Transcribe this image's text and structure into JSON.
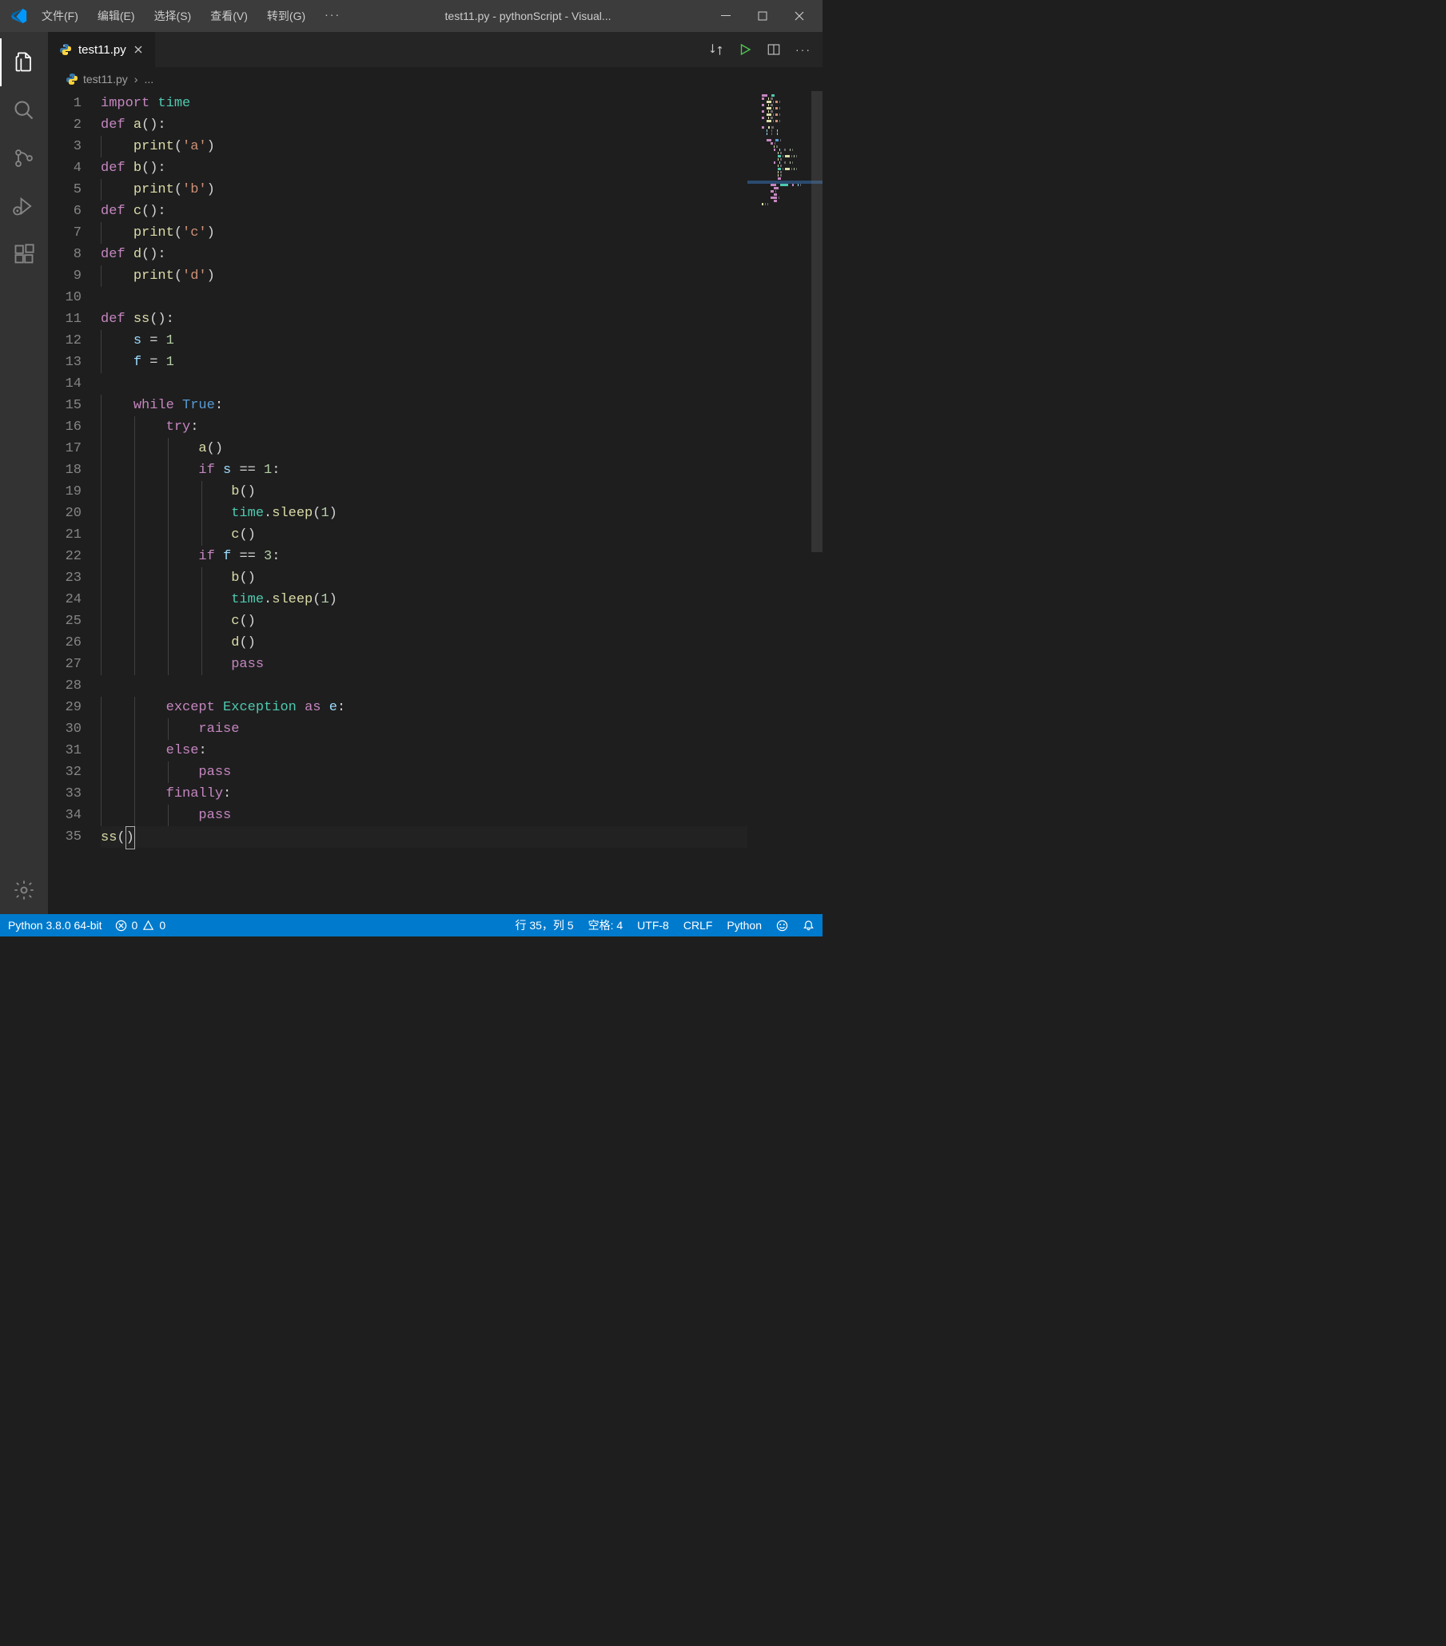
{
  "titlebar": {
    "menus": [
      "文件(F)",
      "编辑(E)",
      "选择(S)",
      "查看(V)",
      "转到(G)"
    ],
    "overflow": "···",
    "title": "test11.py - pythonScript - Visual..."
  },
  "tab": {
    "filename": "test11.py"
  },
  "breadcrumb": {
    "file": "test11.py",
    "sep": "›",
    "more": "..."
  },
  "code": {
    "lines": [
      [
        [
          "kw",
          "import"
        ],
        [
          "plain",
          " "
        ],
        [
          "mod",
          "time"
        ]
      ],
      [
        [
          "kw",
          "def"
        ],
        [
          "plain",
          " "
        ],
        [
          "fn",
          "a"
        ],
        [
          "pun",
          "():"
        ]
      ],
      [
        [
          "plain",
          "    "
        ],
        [
          "fn",
          "print"
        ],
        [
          "pun",
          "("
        ],
        [
          "str",
          "'a'"
        ],
        [
          "pun",
          ")"
        ]
      ],
      [
        [
          "kw",
          "def"
        ],
        [
          "plain",
          " "
        ],
        [
          "fn",
          "b"
        ],
        [
          "pun",
          "():"
        ]
      ],
      [
        [
          "plain",
          "    "
        ],
        [
          "fn",
          "print"
        ],
        [
          "pun",
          "("
        ],
        [
          "str",
          "'b'"
        ],
        [
          "pun",
          ")"
        ]
      ],
      [
        [
          "kw",
          "def"
        ],
        [
          "plain",
          " "
        ],
        [
          "fn",
          "c"
        ],
        [
          "pun",
          "():"
        ]
      ],
      [
        [
          "plain",
          "    "
        ],
        [
          "fn",
          "print"
        ],
        [
          "pun",
          "("
        ],
        [
          "str",
          "'c'"
        ],
        [
          "pun",
          ")"
        ]
      ],
      [
        [
          "kw",
          "def"
        ],
        [
          "plain",
          " "
        ],
        [
          "fn",
          "d"
        ],
        [
          "pun",
          "():"
        ]
      ],
      [
        [
          "plain",
          "    "
        ],
        [
          "fn",
          "print"
        ],
        [
          "pun",
          "("
        ],
        [
          "str",
          "'d'"
        ],
        [
          "pun",
          ")"
        ]
      ],
      [],
      [
        [
          "kw",
          "def"
        ],
        [
          "plain",
          " "
        ],
        [
          "fn",
          "ss"
        ],
        [
          "pun",
          "():"
        ]
      ],
      [
        [
          "plain",
          "    "
        ],
        [
          "var",
          "s"
        ],
        [
          "plain",
          " "
        ],
        [
          "pun",
          "="
        ],
        [
          "plain",
          " "
        ],
        [
          "num",
          "1"
        ]
      ],
      [
        [
          "plain",
          "    "
        ],
        [
          "var",
          "f"
        ],
        [
          "plain",
          " "
        ],
        [
          "pun",
          "="
        ],
        [
          "plain",
          " "
        ],
        [
          "num",
          "1"
        ]
      ],
      [],
      [
        [
          "plain",
          "    "
        ],
        [
          "kw",
          "while"
        ],
        [
          "plain",
          " "
        ],
        [
          "const",
          "True"
        ],
        [
          "pun",
          ":"
        ]
      ],
      [
        [
          "plain",
          "        "
        ],
        [
          "kw",
          "try"
        ],
        [
          "pun",
          ":"
        ]
      ],
      [
        [
          "plain",
          "            "
        ],
        [
          "fn",
          "a"
        ],
        [
          "pun",
          "()"
        ]
      ],
      [
        [
          "plain",
          "            "
        ],
        [
          "kw",
          "if"
        ],
        [
          "plain",
          " "
        ],
        [
          "var",
          "s"
        ],
        [
          "plain",
          " "
        ],
        [
          "pun",
          "=="
        ],
        [
          "plain",
          " "
        ],
        [
          "num",
          "1"
        ],
        [
          "pun",
          ":"
        ]
      ],
      [
        [
          "plain",
          "                "
        ],
        [
          "fn",
          "b"
        ],
        [
          "pun",
          "()"
        ]
      ],
      [
        [
          "plain",
          "                "
        ],
        [
          "mod",
          "time"
        ],
        [
          "pun",
          "."
        ],
        [
          "fn",
          "sleep"
        ],
        [
          "pun",
          "("
        ],
        [
          "num",
          "1"
        ],
        [
          "pun",
          ")"
        ]
      ],
      [
        [
          "plain",
          "                "
        ],
        [
          "fn",
          "c"
        ],
        [
          "pun",
          "()"
        ]
      ],
      [
        [
          "plain",
          "            "
        ],
        [
          "kw",
          "if"
        ],
        [
          "plain",
          " "
        ],
        [
          "var",
          "f"
        ],
        [
          "plain",
          " "
        ],
        [
          "pun",
          "=="
        ],
        [
          "plain",
          " "
        ],
        [
          "num",
          "3"
        ],
        [
          "pun",
          ":"
        ]
      ],
      [
        [
          "plain",
          "                "
        ],
        [
          "fn",
          "b"
        ],
        [
          "pun",
          "()"
        ]
      ],
      [
        [
          "plain",
          "                "
        ],
        [
          "mod",
          "time"
        ],
        [
          "pun",
          "."
        ],
        [
          "fn",
          "sleep"
        ],
        [
          "pun",
          "("
        ],
        [
          "num",
          "1"
        ],
        [
          "pun",
          ")"
        ]
      ],
      [
        [
          "plain",
          "                "
        ],
        [
          "fn",
          "c"
        ],
        [
          "pun",
          "()"
        ]
      ],
      [
        [
          "plain",
          "                "
        ],
        [
          "fn",
          "d"
        ],
        [
          "pun",
          "()"
        ]
      ],
      [
        [
          "plain",
          "                "
        ],
        [
          "kw",
          "pass"
        ]
      ],
      [],
      [
        [
          "plain",
          "        "
        ],
        [
          "kw",
          "except"
        ],
        [
          "plain",
          " "
        ],
        [
          "mod",
          "Exception"
        ],
        [
          "plain",
          " "
        ],
        [
          "kw",
          "as"
        ],
        [
          "plain",
          " "
        ],
        [
          "var",
          "e"
        ],
        [
          "pun",
          ":"
        ]
      ],
      [
        [
          "plain",
          "            "
        ],
        [
          "kw",
          "raise"
        ]
      ],
      [
        [
          "plain",
          "        "
        ],
        [
          "kw",
          "else"
        ],
        [
          "pun",
          ":"
        ]
      ],
      [
        [
          "plain",
          "            "
        ],
        [
          "kw",
          "pass"
        ]
      ],
      [
        [
          "plain",
          "        "
        ],
        [
          "kw",
          "finally"
        ],
        [
          "pun",
          ":"
        ]
      ],
      [
        [
          "plain",
          "            "
        ],
        [
          "kw",
          "pass"
        ]
      ],
      [
        [
          "fn",
          "ss"
        ],
        [
          "pun",
          "("
        ],
        [
          "curs",
          ")"
        ]
      ]
    ]
  },
  "status": {
    "python_version": "Python 3.8.0 64-bit",
    "errors": "0",
    "warnings": "0",
    "cursor": "行 35，列 5",
    "spaces": "空格: 4",
    "encoding": "UTF-8",
    "eol": "CRLF",
    "lang": "Python"
  }
}
